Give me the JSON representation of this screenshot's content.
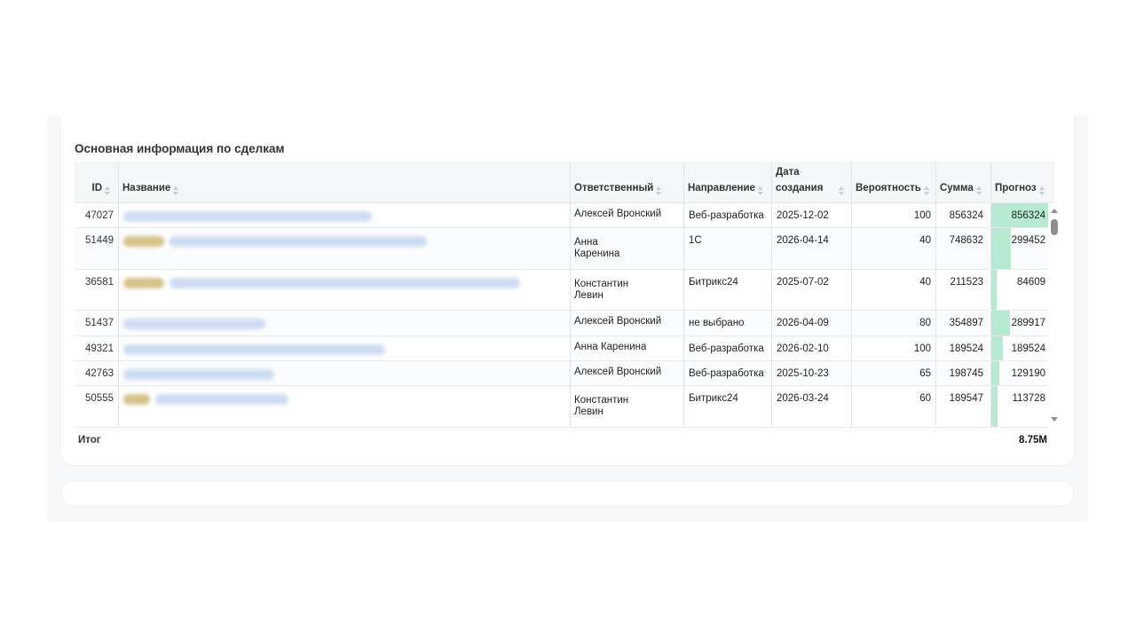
{
  "section_title": "Основная информация по сделкам",
  "columns": {
    "id": "ID",
    "name": "Название",
    "responsible": "Ответственный",
    "direction": "Направление",
    "date_line1": "Дата",
    "date_line2": "создания",
    "probability": "Вероятность",
    "amount": "Сумма",
    "forecast": "Прогноз"
  },
  "rows": [
    {
      "id": "47027",
      "responsible": [
        "Алексей Вронский"
      ],
      "direction": "Веб-разработка",
      "date": "2025-12-02",
      "probability": "100",
      "amount": "856324",
      "forecast": "856324",
      "forecast_ratio": 1.0
    },
    {
      "id": "51449",
      "responsible": [
        "Анна",
        "Каренина"
      ],
      "direction": "1С",
      "date": "2026-04-14",
      "probability": "40",
      "amount": "748632",
      "forecast": "299452",
      "forecast_ratio": 0.35
    },
    {
      "id": "36581",
      "responsible": [
        "Константин",
        "Левин"
      ],
      "direction": "Битрикс24",
      "date": "2025-07-02",
      "probability": "40",
      "amount": "211523",
      "forecast": "84609",
      "forecast_ratio": 0.1
    },
    {
      "id": "51437",
      "responsible": [
        "Алексей Вронский"
      ],
      "direction": "не выбрано",
      "date": "2026-04-09",
      "probability": "80",
      "amount": "354897",
      "forecast": "289917",
      "forecast_ratio": 0.34
    },
    {
      "id": "49321",
      "responsible": [
        "Анна Каренина"
      ],
      "direction": "Веб-разработка",
      "date": "2026-02-10",
      "probability": "100",
      "amount": "189524",
      "forecast": "189524",
      "forecast_ratio": 0.22
    },
    {
      "id": "42763",
      "responsible": [
        "Алексей Вронский"
      ],
      "direction": "Веб-разработка",
      "date": "2025-10-23",
      "probability": "65",
      "amount": "198745",
      "forecast": "129190",
      "forecast_ratio": 0.15
    },
    {
      "id": "50555",
      "responsible": [
        "Константин",
        "Левин"
      ],
      "direction": "Битрикс24",
      "date": "2026-03-24",
      "probability": "60",
      "amount": "189547",
      "forecast": "113728",
      "forecast_ratio": 0.13
    }
  ],
  "footer": {
    "total_label": "Итог",
    "total_value": "8.75M"
  },
  "colors": {
    "forecast_bar": "#b6ebd2",
    "header_bg": "#f4f7f8"
  }
}
